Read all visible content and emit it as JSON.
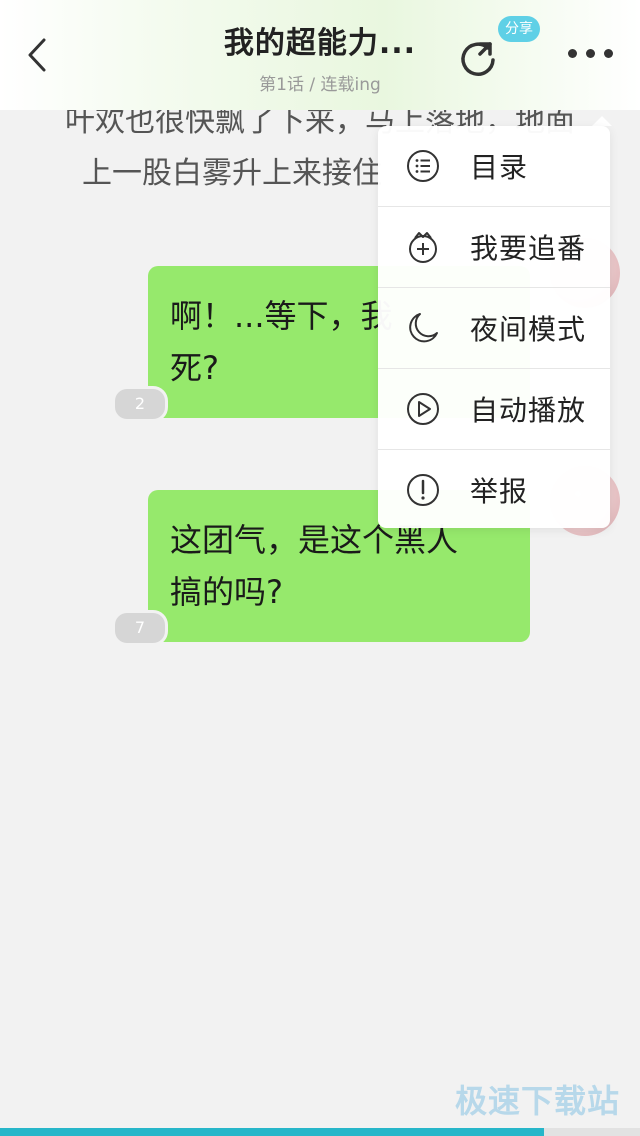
{
  "header": {
    "title": "我的超能力...",
    "subtitle": "第1话 / 连载ing",
    "share_badge": "分享"
  },
  "narration": {
    "line1": "叶欢也很快飘了下来，马上落地，地面",
    "line2": "上一股白雾升上来接住"
  },
  "messages": [
    {
      "text": "啊！...等下，我",
      "text2": "死?",
      "count": "2"
    },
    {
      "text": "这团气，是这个黑人",
      "text2": "搞的吗?",
      "count": "7"
    }
  ],
  "menu": {
    "items": [
      {
        "label": "目录",
        "icon": "list-icon"
      },
      {
        "label": "我要追番",
        "icon": "follow-plus-icon"
      },
      {
        "label": "夜间模式",
        "icon": "moon-icon"
      },
      {
        "label": "自动播放",
        "icon": "play-icon"
      },
      {
        "label": "举报",
        "icon": "report-icon"
      }
    ]
  },
  "watermark": "极速下载站",
  "progress": {
    "fraction": 0.85
  },
  "colors": {
    "bubble": "#96e96c",
    "accent": "#27b6c9",
    "share_badge": "#5fd0e6"
  }
}
